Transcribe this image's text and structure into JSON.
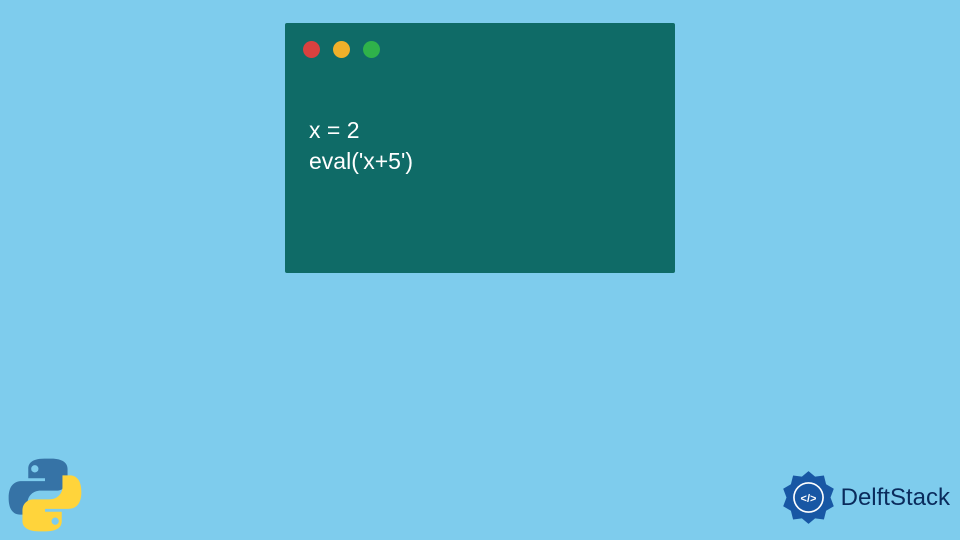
{
  "code": {
    "lines": [
      "x = 2",
      "eval('x+5')"
    ]
  },
  "brand": {
    "name": "DelftStack"
  },
  "colors": {
    "background": "#7ecced",
    "window": "#0f6b67",
    "red": "#d8413f",
    "yellow": "#f0b02a",
    "green": "#2fb24a",
    "brandText": "#0a2b5c",
    "brandAccent": "#1857a4"
  }
}
